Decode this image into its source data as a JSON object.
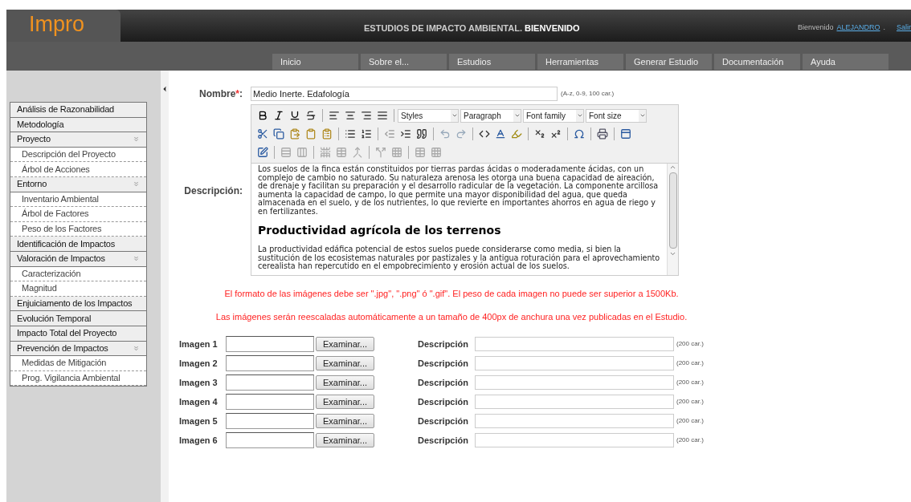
{
  "header": {
    "logo": "Impro",
    "title": "ESTUDIOS DE IMPACTO AMBIENTAL.",
    "title_bold": "BIENVENIDO",
    "welcome": "Bienvenido",
    "user": "ALEJANDRO",
    "user_suffix": ".",
    "logout": "Salir"
  },
  "nav": [
    "Inicio",
    "Sobre el...",
    "Estudios",
    "Herramientas",
    "Generar Estudio",
    "Documentación",
    "Ayuda"
  ],
  "sidebar": {
    "items": [
      {
        "label": "Análisis de Razonabilidad"
      },
      {
        "label": "Metodología"
      },
      {
        "label": "Proyecto",
        "children": [
          {
            "label": "Descripción del Proyecto"
          },
          {
            "label": "Árbol de Acciones"
          }
        ]
      },
      {
        "label": "Entorno",
        "children": [
          {
            "label": "Inventario Ambiental"
          },
          {
            "label": "Árbol de Factores"
          },
          {
            "label": "Peso de los Factores"
          }
        ]
      },
      {
        "label": "Identificación de Impactos"
      },
      {
        "label": "Valoración de Impactos",
        "children": [
          {
            "label": "Caracterización"
          },
          {
            "label": "Magnitud"
          }
        ]
      },
      {
        "label": "Enjuiciamento de los Impactos"
      },
      {
        "label": "Evolución Temporal"
      },
      {
        "label": "Impacto Total del Proyecto"
      },
      {
        "label": "Prevención de Impactos",
        "children": [
          {
            "label": "Medidas de Mitigación"
          },
          {
            "label": "Prog. Vigilancia Ambiental"
          }
        ]
      }
    ]
  },
  "form": {
    "name_label": "Nombre",
    "required_mark": "*",
    "name_colon": ":",
    "name_value": "Medio Inerte. Edafología",
    "name_hint": "(A-z, 0-9, 100 car.)",
    "description_label": "Descripción:",
    "editor": {
      "selects": [
        "Styles",
        "Paragraph",
        "Font family",
        "Font size"
      ],
      "blocks": [
        {
          "kind": "paragraph",
          "text": "Los suelos de la finca están constituidos por tierras pardas ácidas o moderadamente ácidas, con un complejo de cambio no saturado. Su naturaleza arenosa les otorga una buena capacidad de aireación, de drenaje y facilitan su preparación y el desarrollo radicular de la vegetación. La componente arcillosa aumenta la capacidad de campo, lo que permite una mayor disponibilidad del agua, que queda almacenada en el suelo, y de los nutrientes, lo que revierte en importantes ahorros en agua de riego y en fertilizantes."
        },
        {
          "kind": "heading",
          "text": "Productividad agrícola de los terrenos"
        },
        {
          "kind": "paragraph",
          "text": "La productividad edáfica potencial de estos suelos puede considerarse como media, si bien la sustitución de los ecosistemas naturales por pastizales y la antigua roturación para el aprovechamiento cerealista han repercutido en el empobrecimiento y erosión actual de los suelos."
        }
      ]
    },
    "notes": [
      "El formato de las imágenes debe ser \".jpg\", \".png\" ó \".gif\". El peso de cada imagen no puede ser superior a 1500Kb.",
      "Las imágenes serán reescaladas automáticamente a un tamaño de 400px de anchura una vez publicadas en el Estudio."
    ],
    "images": [
      {
        "label": "Imagen 1",
        "button": "Examinar...",
        "description_label": "Descripción",
        "hint": "(200 car.)"
      },
      {
        "label": "Imagen 2",
        "button": "Examinar...",
        "description_label": "Descripción",
        "hint": "(200 car.)"
      },
      {
        "label": "Imagen 3",
        "button": "Examinar...",
        "description_label": "Descripción",
        "hint": "(200 car.)"
      },
      {
        "label": "Imagen 4",
        "button": "Examinar...",
        "description_label": "Descripción",
        "hint": "(200 car.)"
      },
      {
        "label": "Imagen 5",
        "button": "Examinar...",
        "description_label": "Descripción",
        "hint": "(200 car.)"
      },
      {
        "label": "Imagen 6",
        "button": "Examinar...",
        "description_label": "Descripción",
        "hint": "(200 car.)"
      }
    ]
  }
}
